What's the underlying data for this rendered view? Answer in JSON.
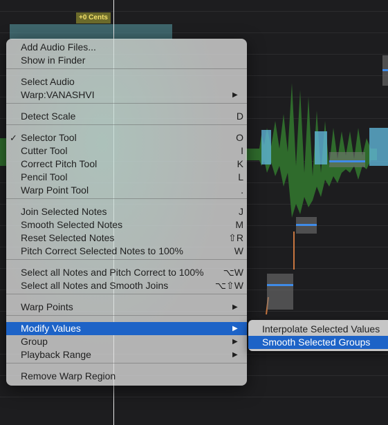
{
  "editor": {
    "cents_tag": "+0 Cents"
  },
  "menu": {
    "items": [
      {
        "label": "Add Audio Files...",
        "key": "",
        "submenu": false,
        "checked": false
      },
      {
        "label": "Show in Finder",
        "key": "",
        "submenu": false,
        "checked": false
      },
      {
        "label": "Select Audio",
        "key": "",
        "submenu": false,
        "checked": false
      },
      {
        "label": "Warp:VANASHVI",
        "key": "",
        "submenu": true,
        "checked": false
      },
      {
        "label": "Detect Scale",
        "key": "D",
        "submenu": false,
        "checked": false
      },
      {
        "label": "Selector Tool",
        "key": "O",
        "submenu": false,
        "checked": true
      },
      {
        "label": "Cutter Tool",
        "key": "I",
        "submenu": false,
        "checked": false
      },
      {
        "label": "Correct Pitch Tool",
        "key": "K",
        "submenu": false,
        "checked": false
      },
      {
        "label": "Pencil Tool",
        "key": "L",
        "submenu": false,
        "checked": false
      },
      {
        "label": "Warp Point Tool",
        "key": ".",
        "submenu": false,
        "checked": false
      },
      {
        "label": "Join Selected Notes",
        "key": "J",
        "submenu": false,
        "checked": false
      },
      {
        "label": "Smooth Selected Notes",
        "key": "M",
        "submenu": false,
        "checked": false
      },
      {
        "label": "Reset Selected Notes",
        "key": "⇧R",
        "submenu": false,
        "checked": false
      },
      {
        "label": "Pitch Correct Selected Notes to 100%",
        "key": "W",
        "submenu": false,
        "checked": false
      },
      {
        "label": "Select all Notes and Pitch Correct to 100%",
        "key": "⌥W",
        "submenu": false,
        "checked": false
      },
      {
        "label": "Select all Notes and Smooth Joins",
        "key": "⌥⇧W",
        "submenu": false,
        "checked": false
      },
      {
        "label": "Warp Points",
        "key": "",
        "submenu": true,
        "checked": false
      },
      {
        "label": "Modify Values",
        "key": "",
        "submenu": true,
        "checked": false,
        "active": true
      },
      {
        "label": "Group",
        "key": "",
        "submenu": true,
        "checked": false
      },
      {
        "label": "Playback Range",
        "key": "",
        "submenu": true,
        "checked": false
      },
      {
        "label": "Remove Warp Region",
        "key": "",
        "submenu": false,
        "checked": false
      }
    ],
    "check_glyph": "✓",
    "arrow_glyph": "▶"
  },
  "submenu": {
    "items": [
      {
        "label": "Interpolate Selected Values",
        "active": false
      },
      {
        "label": "Smooth Selected Groups",
        "active": true
      }
    ]
  },
  "colors": {
    "highlight": "#1d63c7",
    "waveform_green": "#2f6b2c",
    "waveform_blue": "#5fb4d6",
    "pitch_line": "#3f8be8"
  }
}
